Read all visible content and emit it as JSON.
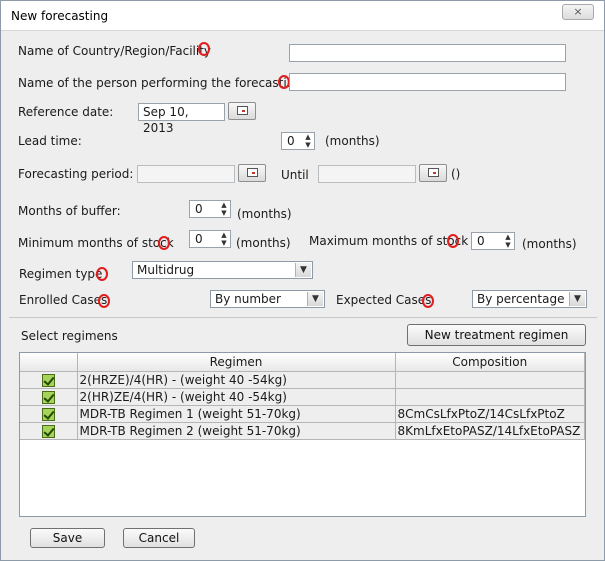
{
  "window": {
    "title": "New forecasting",
    "close_glyph": "×"
  },
  "form": {
    "country_label": "Name of Country/Region/Facility",
    "country_value": "",
    "person_label": "Name of the person performing the forecasting",
    "person_value": "",
    "reference_date_label": "Reference date:",
    "reference_date_value": "Sep 10, 2013",
    "lead_time_label": "Lead time:",
    "lead_time_value": "0",
    "lead_time_unit": "(months)",
    "forecasting_period_label": "Forecasting period:",
    "forecasting_from_value": "",
    "until_label": "Until",
    "forecasting_until_value": "",
    "period_parens": "()",
    "months_buffer_label": "Months of buffer:",
    "months_buffer_value": "0",
    "months_buffer_unit": "(months)",
    "min_stock_label": "Minimum months of stock",
    "min_stock_value": "0",
    "min_stock_unit": "(months)",
    "max_stock_label": "Maximum months of stock",
    "max_stock_value": "0",
    "max_stock_unit": "(months)",
    "regimen_type_label": "Regimen type",
    "regimen_type_value": "Multidrug",
    "enrolled_cases_label": "Enrolled Cases",
    "enrolled_cases_value": "By number",
    "expected_cases_label": "Expected Cases",
    "expected_cases_value": "By percentage"
  },
  "regimens": {
    "section_label": "Select regimens",
    "new_button": "New treatment regimen",
    "columns": [
      "",
      "Regimen",
      "Composition"
    ],
    "rows": [
      {
        "checked": true,
        "regimen": "2(HRZE)/4(HR) - (weight 40 -54kg)",
        "composition": ""
      },
      {
        "checked": true,
        "regimen": "2(HR)ZE/4(HR) - (weight 40 -54kg)",
        "composition": ""
      },
      {
        "checked": true,
        "regimen": "MDR-TB Regimen 1 (weight 51-70kg)",
        "composition": "8CmCsLfxPtoZ/14CsLfxPtoZ"
      },
      {
        "checked": true,
        "regimen": "MDR-TB Regimen 2 (weight 51-70kg)",
        "composition": "8KmLfxEtoPASZ/14LfxEtoPASZ"
      }
    ]
  },
  "footer": {
    "save": "Save",
    "cancel": "Cancel"
  },
  "icons": {
    "spinner_up": "▲",
    "spinner_down": "▼",
    "dropdown": "▼"
  },
  "colors": {
    "annotation": "#e11d1d",
    "checkbox": "#a6d35a"
  }
}
